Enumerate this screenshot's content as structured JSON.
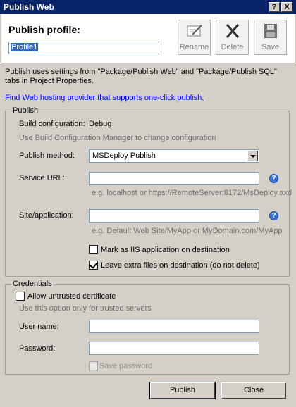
{
  "window": {
    "title": "Publish Web",
    "help_btn": "?",
    "close_btn": "X"
  },
  "header": {
    "profile_label": "Publish profile:",
    "profile_value": "Profile1",
    "buttons": [
      {
        "label": "Rename",
        "icon": "rename-icon"
      },
      {
        "label": "Delete",
        "icon": "delete-icon"
      },
      {
        "label": "Save",
        "icon": "save-icon"
      }
    ]
  },
  "description": "Publish uses settings from \"Package/Publish Web\" and \"Package/Publish SQL\" tabs in Project Properties.",
  "hosting_link": "Find Web hosting provider that supports one-click publish.",
  "publish": {
    "legend": "Publish",
    "build_config_label": "Build configuration:",
    "build_config_value": "Debug",
    "build_config_hint": "Use Build Configuration Manager to change configuration",
    "method_label": "Publish method:",
    "method_value": "MSDeploy Publish",
    "service_url_label": "Service URL:",
    "service_url_value": "",
    "service_url_hint": "e.g. localhost or https://RemoteServer:8172/MsDeploy.axd",
    "site_label": "Site/application:",
    "site_value": "",
    "site_hint": "e.g. Default Web Site/MyApp or MyDomain.com/MyApp",
    "mark_iis_label": "Mark as IIS application on destination",
    "mark_iis_checked": false,
    "leave_extra_label": "Leave extra files on destination (do not delete)",
    "leave_extra_checked": true
  },
  "credentials": {
    "legend": "Credentials",
    "untrusted_label": "Allow untrusted certificate",
    "untrusted_checked": false,
    "untrusted_hint": "Use this option only for trusted servers",
    "username_label": "User name:",
    "username_value": "",
    "password_label": "Password:",
    "password_value": "",
    "save_password_label": "Save password",
    "save_password_checked": false
  },
  "footer": {
    "publish_label": "Publish",
    "close_label": "Close"
  },
  "colors": {
    "titlebar": "#0a246a",
    "dialog": "#d4d0c8",
    "link": "#0000ff",
    "help": "#3b74d4"
  }
}
